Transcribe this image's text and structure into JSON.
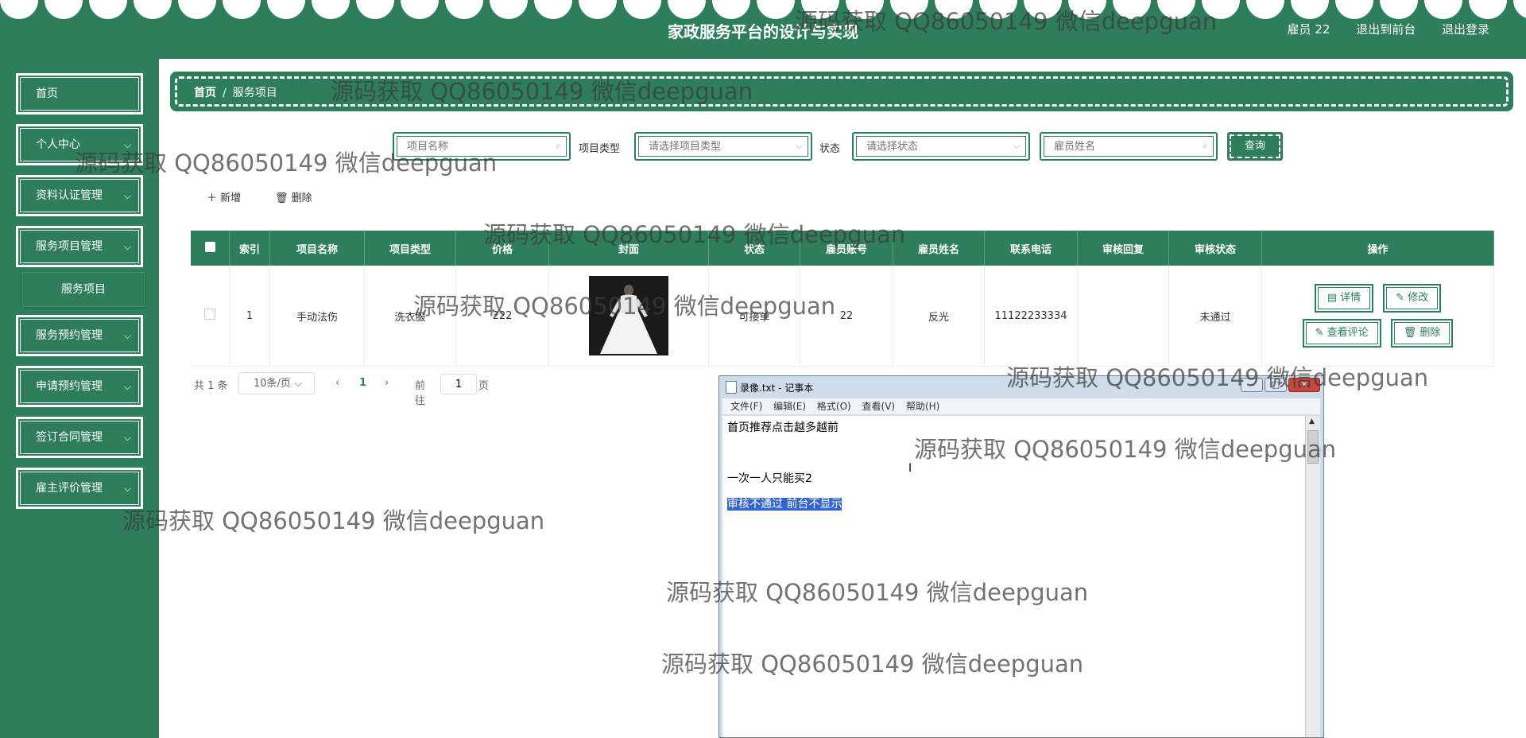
{
  "header": {
    "title": "家政服务平台的设计与实现",
    "user": "雇员 22",
    "back_to_front": "退出到前台",
    "logout": "退出登录"
  },
  "sidebar": {
    "items": [
      {
        "label": "首页"
      },
      {
        "label": "个人中心"
      },
      {
        "label": "资料认证管理"
      },
      {
        "label": "服务项目管理"
      },
      {
        "label": "服务预约管理"
      },
      {
        "label": "申请预约管理"
      },
      {
        "label": "签订合同管理"
      },
      {
        "label": "雇主评价管理"
      }
    ],
    "sub_item": "服务项目"
  },
  "breadcrumb": {
    "home": "首页",
    "sep": "/",
    "current": "服务项目"
  },
  "search": {
    "name_placeholder": "项目名称",
    "type_label": "项目类型",
    "type_placeholder": "请选择项目类型",
    "status_label": "状态",
    "status_placeholder": "请选择状态",
    "employee_placeholder": "雇员姓名",
    "query_button": "查询"
  },
  "actions": {
    "add": "新增",
    "delete": "删除"
  },
  "table": {
    "columns": [
      "索引",
      "项目名称",
      "项目类型",
      "价格",
      "封面",
      "状态",
      "雇员账号",
      "雇员姓名",
      "联系电话",
      "审核回复",
      "审核状态",
      "操作"
    ],
    "rows": [
      {
        "index": "1",
        "name": "手动法伤",
        "type": "洗衣服",
        "price": "222",
        "status": "可接单",
        "account": "22",
        "employee": "反光",
        "phone": "11122233334",
        "reply": "",
        "audit": "未通过"
      }
    ],
    "row_buttons": {
      "detail": "详情",
      "edit": "修改",
      "comments": "查看评论",
      "delete": "删除"
    }
  },
  "pagination": {
    "total": "共 1 条",
    "page_size": "10条/页",
    "prev": "‹",
    "current": "1",
    "next": "›",
    "goto_prefix": "前往",
    "goto_value": "1",
    "goto_suffix": "页"
  },
  "notepad": {
    "title": "录像.txt - 记事本",
    "menu": [
      "文件(F)",
      "编辑(E)",
      "格式(O)",
      "查看(V)",
      "帮助(H)"
    ],
    "lines": [
      "首页推荐点击越多越前",
      "一次一人只能买2",
      "审核不通过   前台不显示"
    ]
  },
  "watermark": "源码获取 QQ86050149 微信deepguan",
  "colors": {
    "primary": "#2e7d5b",
    "header_text": "#ffffff"
  }
}
